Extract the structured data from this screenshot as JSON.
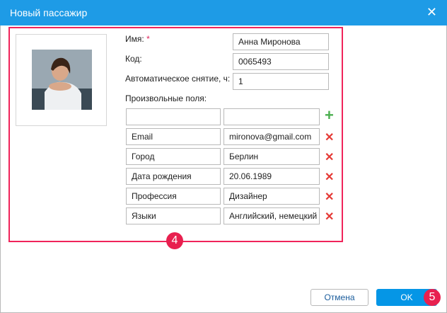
{
  "dialog": {
    "title": "Новый пассажир"
  },
  "form": {
    "name_label": "Имя:",
    "required_mark": "*",
    "name_value": "Анна Миронова",
    "code_label": "Код:",
    "code_value": "0065493",
    "auto_label": "Автоматическое снятие, ч:",
    "auto_value": "1",
    "custom_label": "Произвольные поля:",
    "custom_fields": [
      {
        "key": "Email",
        "value": "mironova@gmail.com"
      },
      {
        "key": "Город",
        "value": "Берлин"
      },
      {
        "key": "Дата рождения",
        "value": "20.06.1989"
      },
      {
        "key": "Профессия",
        "value": "Дизайнер"
      },
      {
        "key": "Языки",
        "value": "Английский, немецкий"
      }
    ]
  },
  "icons": {
    "add": "+",
    "remove": "✕",
    "close": "✕"
  },
  "badges": {
    "form": "4",
    "ok": "5"
  },
  "buttons": {
    "cancel": "Отмена",
    "ok": "OK"
  }
}
